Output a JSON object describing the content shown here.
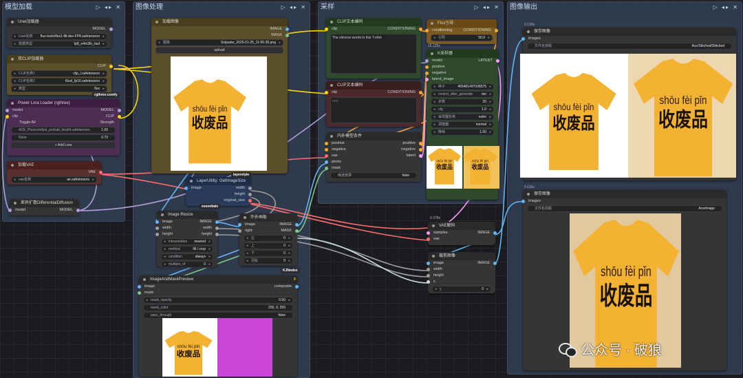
{
  "groups": {
    "model_load": "模型加载",
    "image_process": "图像处理",
    "sampling": "采样",
    "image_output": "图像输出",
    "controls": "▷ ◂▸ ✕"
  },
  "nodes": {
    "unet": {
      "title": "Unet加载器",
      "out_model": "MODEL",
      "unet_name_label": "Unet名称",
      "unet_name_value": "flux-tools\\flux1-fill-dev-FP8.safetensors",
      "dtype_label": "数据类型",
      "dtype_value": "fp8_e4m3fn_fast"
    },
    "dual_clip": {
      "title": "双CLIP加载器",
      "out_clip": "CLIP",
      "clip1_label": "CLIP名称1",
      "clip1_value": "clip_l.safetensors",
      "clip2_label": "CLIP名称2",
      "clip2_value": "t5xxl_fp16.safetensors",
      "type_label": "类型",
      "type_value": "flux",
      "tag": "rgthree-comfy"
    },
    "lora": {
      "title": "Power Lora Loader (rgthree)",
      "in_model": "model",
      "in_clip": "clip",
      "out_model": "MODEL",
      "out_clip": "CLIP",
      "toggle_all": "Toggle All",
      "strength": "Strength",
      "lora1_value": "ACE_Plus\\comfyui_portrait_lora64.safetensors",
      "lora1_strength": "1.00",
      "lora2_value": "None",
      "lora2_strength": "0.70",
      "add_lora": "+ Add Lora"
    },
    "vae_loader": {
      "title": "加载VAE",
      "out_vae": "VAE",
      "vae_label": "vae名称",
      "vae_value": "ae.safetensors"
    },
    "diff_diff": {
      "title": "差异扩散DifferentialDiffusion",
      "in_model": "model",
      "out_model": "MODEL"
    },
    "load_image": {
      "title": "加载图像",
      "out_image": "IMAGE",
      "out_mask": "MASK",
      "image_label": "图像",
      "image_value": "Snipaste_2025-01-25_11-56-35.png",
      "upload": "upload"
    },
    "get_size": {
      "title": "LayerUtility: GetImageSize",
      "in_image": "image",
      "out_width": "width",
      "out_height": "height",
      "out_original": "original_size",
      "tag": "essentials",
      "tag2": "layerstyle"
    },
    "resize": {
      "title": "Image Resize",
      "in_image": "image",
      "in_width": "width",
      "in_height": "height",
      "out_image": "IMAGE",
      "out_width": "width",
      "out_height": "height",
      "interp_label": "interpolation",
      "interp_value": "nearest",
      "method_label": "method",
      "method_value": "fill / crop",
      "cond_label": "condition",
      "cond_value": "always",
      "mult_label": "multiple_of",
      "mult_value": "0",
      "tag": "KJNodes"
    },
    "pad": {
      "title": "外补画板",
      "in_image": "image",
      "in_right": "right",
      "out_image": "IMAGE",
      "out_mask": "MASK",
      "left_label": "左",
      "left_value": "0",
      "top_label": "上",
      "top_value": "0",
      "bottom_label": "下",
      "bottom_value": "0",
      "feather_label": "羽化",
      "feather_value": "0"
    },
    "mask_preview": {
      "title": "ImageAndMaskPreview",
      "in_image": "image",
      "in_mask": "mask",
      "out_composite": "composite",
      "opacity_label": "mask_opacity",
      "opacity_value": "0.50",
      "color_label": "mask_color",
      "color_value": "255, 0, 255",
      "pass_label": "pass_through",
      "pass_value": "false",
      "badge": "9"
    },
    "clip_pos": {
      "title": "CLIP文本编码",
      "in_clip": "clip",
      "out_cond": "CONDITIONING",
      "text": "The chinese words in this T-shirt"
    },
    "clip_neg": {
      "title": "CLIP文本编码",
      "in_clip": "clip",
      "out_cond": "CONDITIONING",
      "text": "text"
    },
    "flux_guidance": {
      "title": "Flux引导",
      "in_cond": "conditioning",
      "out_cond": "CONDITIONING",
      "guidance_label": "引导",
      "guidance_value": "50.0",
      "timer": "15.125s"
    },
    "inpaint_cond": {
      "title": "内补模型条件",
      "in_positive": "positive",
      "in_negative": "negative",
      "in_vae": "vae",
      "in_pixels": "pixels",
      "in_mask": "mask",
      "out_positive": "positive",
      "out_negative": "negative",
      "out_latent": "latent",
      "noise_label": "噪波遮罩",
      "noise_value": "false"
    },
    "ksampler": {
      "title": "K采样器",
      "in_model": "model",
      "in_positive": "positive",
      "in_negative": "negative",
      "in_latent": "latent_image",
      "out_latent": "LATENT",
      "seed_label": "种子",
      "seed_value": "465481497036575",
      "control_label": "control_after_generate",
      "control_value": "ran",
      "steps_label": "步数",
      "steps_value": "20",
      "cfg_label": "cfg",
      "cfg_value": "1.0",
      "sampler_label": "采样器名称",
      "sampler_value": "euler",
      "scheduler_label": "调度器",
      "scheduler_value": "normal",
      "denoise_label": "降噪",
      "denoise_value": "1.00"
    },
    "vae_decode": {
      "title": "VAE解码",
      "in_samples": "samples",
      "in_vae": "vae",
      "out_image": "IMAGE",
      "timer": "0.378s"
    },
    "crop": {
      "title": "裁剪图像",
      "in_image": "image",
      "in_width": "width",
      "in_height": "height",
      "in_x": "x",
      "out_image": "IMAGE",
      "y_label": "y",
      "y_value": "0"
    },
    "save1": {
      "title": "保存图像",
      "in_images": "images",
      "prefix_label": "文件名前缀",
      "prefix_value": "Ace/Stitched/Stitched",
      "timer": "0.130s"
    },
    "save2": {
      "title": "保存图像",
      "in_images": "images",
      "prefix_label": "文件名前缀",
      "prefix_value": "Ace/image",
      "timer": "0.116s"
    }
  },
  "shirt_text": {
    "pinyin1": "shōu",
    "pinyin2": "fèi",
    "pinyin3": "pǐn",
    "hanzi": "收废品"
  },
  "watermark": "公众号 · 破狼",
  "colors": {
    "shirt": "#f4b232",
    "model_link": "#b39ddb",
    "clip_link": "#ffd500",
    "vae_link": "#ff6e6e",
    "image_link": "#64b5f6",
    "cond_link": "#ffa931",
    "mask_link": "#81c784",
    "latent_link": "#ff9cf9"
  }
}
